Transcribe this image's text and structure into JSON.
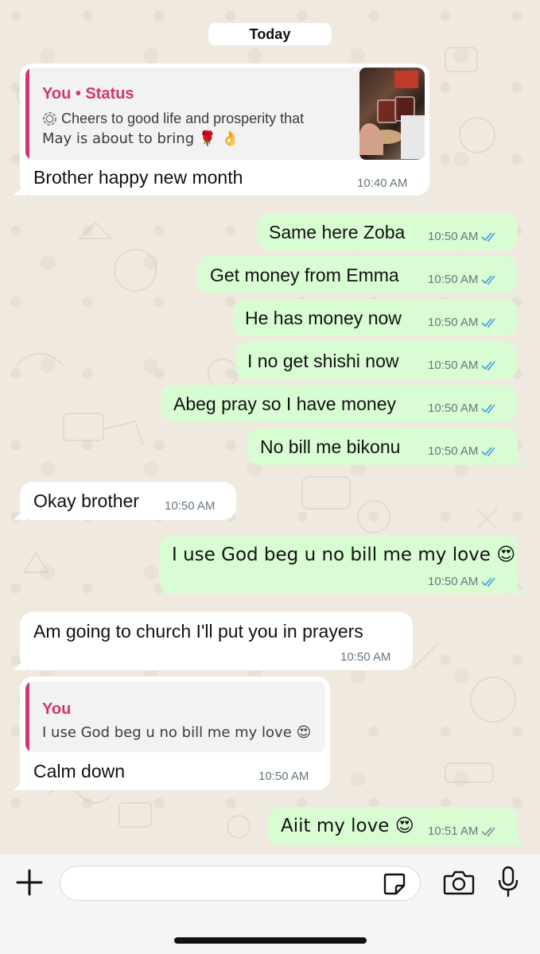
{
  "date_separator": "Today",
  "messages": [
    {
      "direction": "in",
      "quote": {
        "author": "You • Status",
        "status_icon": "status-ring-icon",
        "text_line1": "Cheers to good life and prosperity that",
        "text_line2": "May is about to bring 🌹 👌"
      },
      "text": "Brother happy new month",
      "time": "10:40 AM"
    },
    {
      "direction": "out",
      "text": "Same here Zoba",
      "time": "10:50 AM",
      "status": "read"
    },
    {
      "direction": "out",
      "text": "Get money from Emma",
      "time": "10:50 AM",
      "status": "read"
    },
    {
      "direction": "out",
      "text": "He has money now",
      "time": "10:50 AM",
      "status": "read"
    },
    {
      "direction": "out",
      "text": "I no get shishi now",
      "time": "10:50 AM",
      "status": "read"
    },
    {
      "direction": "out",
      "text": "Abeg pray so I have money",
      "time": "10:50 AM",
      "status": "read"
    },
    {
      "direction": "out",
      "text": "No bill me bikonu",
      "time": "10:50 AM",
      "status": "read"
    },
    {
      "direction": "in",
      "text": "Okay brother",
      "time": "10:50 AM"
    },
    {
      "direction": "out",
      "text": "I use God beg u no bill me my love 😍",
      "time": "10:50 AM",
      "status": "read"
    },
    {
      "direction": "in",
      "text": "Am going to church I'll put you in prayers",
      "time": "10:50 AM"
    },
    {
      "direction": "in",
      "quote": {
        "author": "You",
        "text": "I use God beg u no bill me my love 😍"
      },
      "text": "Calm down",
      "time": "10:50 AM"
    },
    {
      "direction": "out",
      "text": "Aiit my love 😍",
      "time": "10:51 AM",
      "status": "delivered"
    }
  ],
  "composer": {
    "value": "",
    "icons": [
      "plus-icon",
      "sticker-icon",
      "camera-icon",
      "microphone-icon"
    ]
  },
  "colors": {
    "outgoing_bubble": "#d9fdd3",
    "incoming_bubble": "#ffffff",
    "quote_accent": "#d1376a",
    "read_ticks": "#4fa3e3",
    "delivered_ticks": "#8696a0"
  }
}
